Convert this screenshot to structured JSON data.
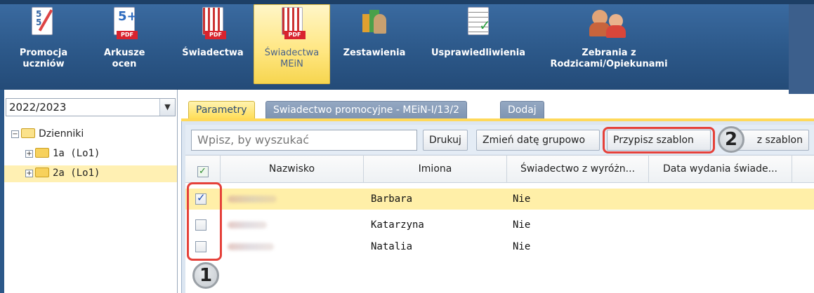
{
  "toolbar": {
    "buttons": [
      {
        "label": "Promocja\nuczniów",
        "icon": "promotion-icon"
      },
      {
        "label": "Arkusze\nocen",
        "icon": "grade-sheet-pdf-icon"
      },
      {
        "label": "Świadectwa",
        "icon": "certificate-pdf-icon"
      },
      {
        "label": "Świadectwa\nMEiN",
        "icon": "certificate-mein-pdf-icon"
      },
      {
        "label": "Zestawienia",
        "icon": "report-chart-icon"
      },
      {
        "label": "Usprawiedliwienia",
        "icon": "excuse-check-icon"
      },
      {
        "label": "Zebrania z\nRodzicami/Opiekunami",
        "icon": "parents-meeting-icon"
      }
    ],
    "pdf_label": "PDF",
    "arkusze_badge": "5+"
  },
  "left": {
    "year": "2022/2023",
    "tree": {
      "root": "Dzienniki",
      "children": [
        "1a (Lo1)",
        "2a (Lo1)"
      ]
    }
  },
  "tabs": [
    "Parametry",
    "Swiadectwo promocyjne - MEiN-I/13/2",
    "Dodaj"
  ],
  "toolbar2": {
    "search_placeholder": "Wpisz, by wyszukać",
    "print": "Drukuj",
    "change_date": "Zmień datę grupowo",
    "assign_template": "Przypisz szablon",
    "remove_template": "z szablon"
  },
  "grid": {
    "headers": [
      "Nazwisko",
      "Imiona",
      "Świadectwo z wyróżn...",
      "Data wydania świade..."
    ],
    "rows": [
      {
        "imiona": "Barbara",
        "wyroznienie": "Nie",
        "checked": true
      },
      {
        "imiona": "Katarzyna",
        "wyroznienie": "Nie",
        "checked": false
      },
      {
        "imiona": "Natalia",
        "wyroznienie": "Nie",
        "checked": false
      }
    ]
  },
  "callouts": [
    "1",
    "2"
  ],
  "colors": {
    "accent": "#ffdd55",
    "toolbar": "#2c5889",
    "highlight": "#e5413a"
  }
}
